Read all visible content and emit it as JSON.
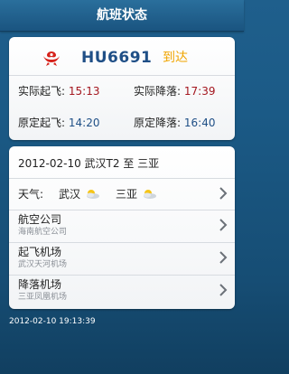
{
  "header": {
    "title": "航班状态"
  },
  "flight": {
    "number": "HU6691",
    "status": "到达",
    "actual_departure_label": "实际起飞:",
    "actual_departure_time": "15:13",
    "actual_landing_label": "实际降落:",
    "actual_landing_time": "17:39",
    "scheduled_departure_label": "原定起飞:",
    "scheduled_departure_time": "14:20",
    "scheduled_landing_label": "原定降落:",
    "scheduled_landing_time": "16:40"
  },
  "details": {
    "route": "2012-02-10  武汉T2 至 三亚",
    "weather_label": "天气:",
    "weather_origin": "武汉",
    "weather_destination": "三亚",
    "airline_label": "航空公司",
    "airline_value": "海南航空公司",
    "departure_airport_label": "起飞机场",
    "departure_airport_value": "武汉天河机场",
    "arrival_airport_label": "降落机场",
    "arrival_airport_value": "三亚凤凰机场"
  },
  "footer": {
    "timestamp": "2012-02-10 19:13:39"
  },
  "colors": {
    "flight_number": "#1f4f86",
    "status": "#f0a500",
    "actual_time": "#a4161f",
    "scheduled_time": "#1f4f86"
  },
  "icons": {
    "airline_logo": "hainan-airlines-logo-icon",
    "weather": "sunny-cloud-icon",
    "chevron": "chevron-right-icon"
  }
}
